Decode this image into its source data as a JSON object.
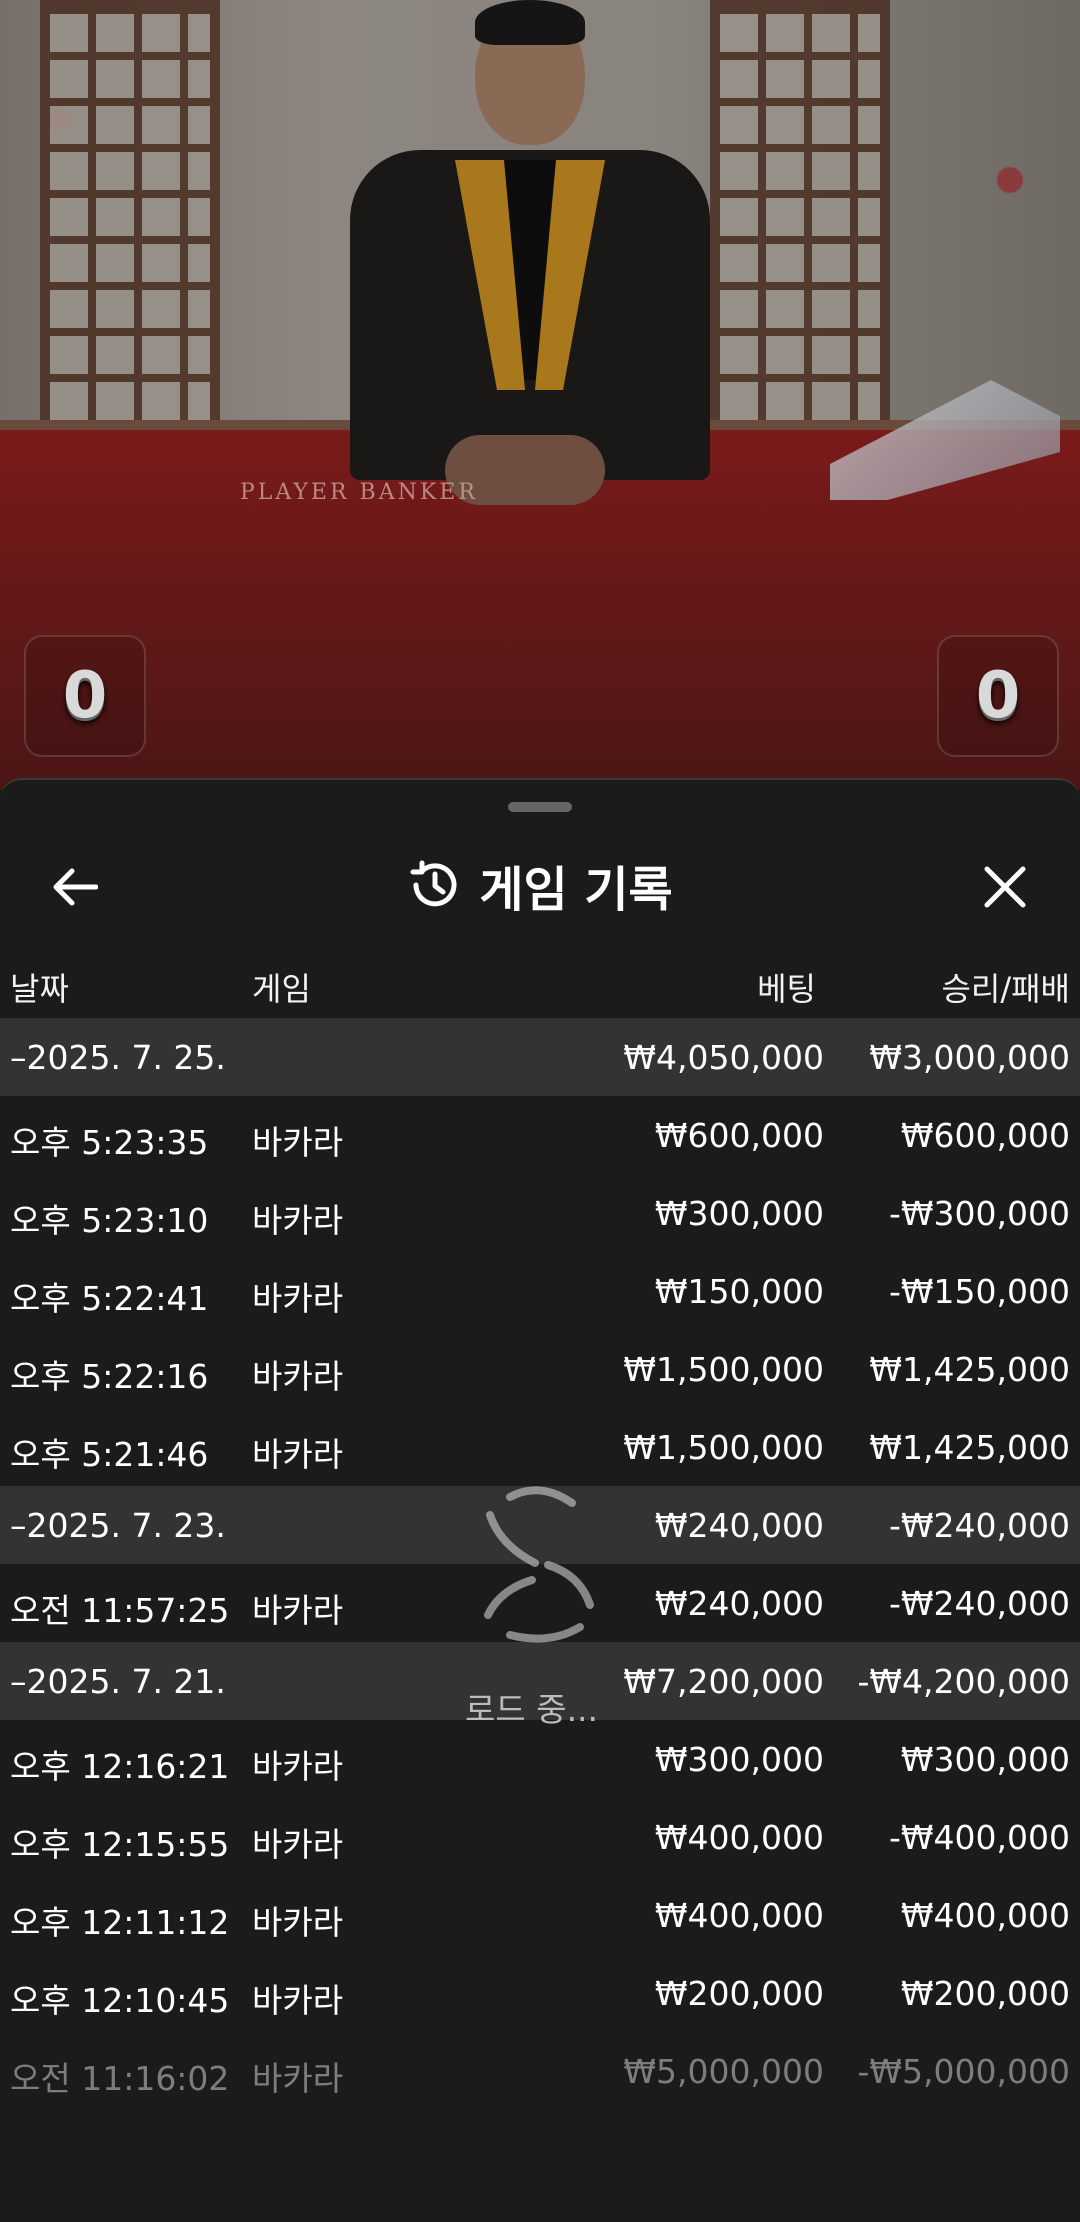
{
  "video": {
    "table_label": "PLAYER   BANKER",
    "player_score": "0",
    "banker_score": "0"
  },
  "sheet": {
    "title": "게임 기록",
    "loading": "로드 중..."
  },
  "columns": {
    "date": "날짜",
    "game": "게임",
    "bet": "베팅",
    "result": "승리/패배"
  },
  "rows": [
    {
      "type": "date",
      "time": "–2025. 7. 25.",
      "game": "",
      "bet": "₩4,050,000",
      "result": "₩3,000,000"
    },
    {
      "type": "item",
      "time": "오후 5:23:35",
      "game": "바카라",
      "bet": "₩600,000",
      "result": "₩600,000"
    },
    {
      "type": "item",
      "time": "오후 5:23:10",
      "game": "바카라",
      "bet": "₩300,000",
      "result": "-₩300,000"
    },
    {
      "type": "item",
      "time": "오후 5:22:41",
      "game": "바카라",
      "bet": "₩150,000",
      "result": "-₩150,000"
    },
    {
      "type": "item",
      "time": "오후 5:22:16",
      "game": "바카라",
      "bet": "₩1,500,000",
      "result": "₩1,425,000"
    },
    {
      "type": "item",
      "time": "오후 5:21:46",
      "game": "바카라",
      "bet": "₩1,500,000",
      "result": "₩1,425,000"
    },
    {
      "type": "date",
      "time": "–2025. 7. 23.",
      "game": "",
      "bet": "₩240,000",
      "result": "-₩240,000"
    },
    {
      "type": "item",
      "time": "오전 11:57:25",
      "game": "바카라",
      "bet": "₩240,000",
      "result": "-₩240,000"
    },
    {
      "type": "date",
      "time": "–2025. 7. 21.",
      "game": "",
      "bet": "₩7,200,000",
      "result": "-₩4,200,000"
    },
    {
      "type": "item",
      "time": "오후 12:16:21",
      "game": "바카라",
      "bet": "₩300,000",
      "result": "₩300,000"
    },
    {
      "type": "item",
      "time": "오후 12:15:55",
      "game": "바카라",
      "bet": "₩400,000",
      "result": "-₩400,000"
    },
    {
      "type": "item",
      "time": "오후 12:11:12",
      "game": "바카라",
      "bet": "₩400,000",
      "result": "₩400,000"
    },
    {
      "type": "item",
      "time": "오후 12:10:45",
      "game": "바카라",
      "bet": "₩200,000",
      "result": "₩200,000"
    },
    {
      "type": "item",
      "time": "오전 11:16:02",
      "game": "바카라",
      "bet": "₩5,000,000",
      "result": "-₩5,000,000",
      "dim": true
    }
  ],
  "icons": {
    "back": "arrow-left-icon",
    "history": "history-icon",
    "close": "close-icon",
    "loader": "loading-spinner-icon"
  }
}
